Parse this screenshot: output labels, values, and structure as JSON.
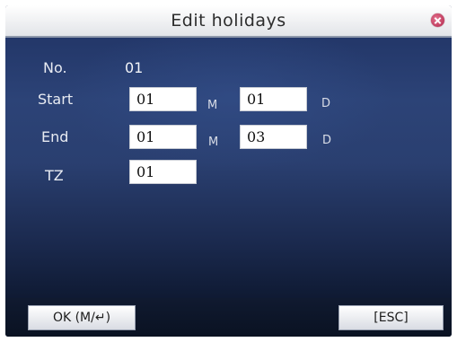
{
  "window": {
    "title": "Edit holidays"
  },
  "form": {
    "no": {
      "label": "No.",
      "value": "01"
    },
    "start": {
      "label": "Start",
      "month": "01",
      "month_unit": "M",
      "day": "01",
      "day_unit": "D"
    },
    "end": {
      "label": "End",
      "month": "01",
      "month_unit": "M",
      "day": "03",
      "day_unit": "D"
    },
    "tz": {
      "label": "TZ",
      "value": "01"
    }
  },
  "buttons": {
    "ok_label": "OK (M/↵)",
    "esc_label": "[ESC]"
  },
  "colors": {
    "background": "#1c2c50",
    "close_icon": "#b1244a"
  },
  "icons": {
    "close": "close-icon"
  }
}
